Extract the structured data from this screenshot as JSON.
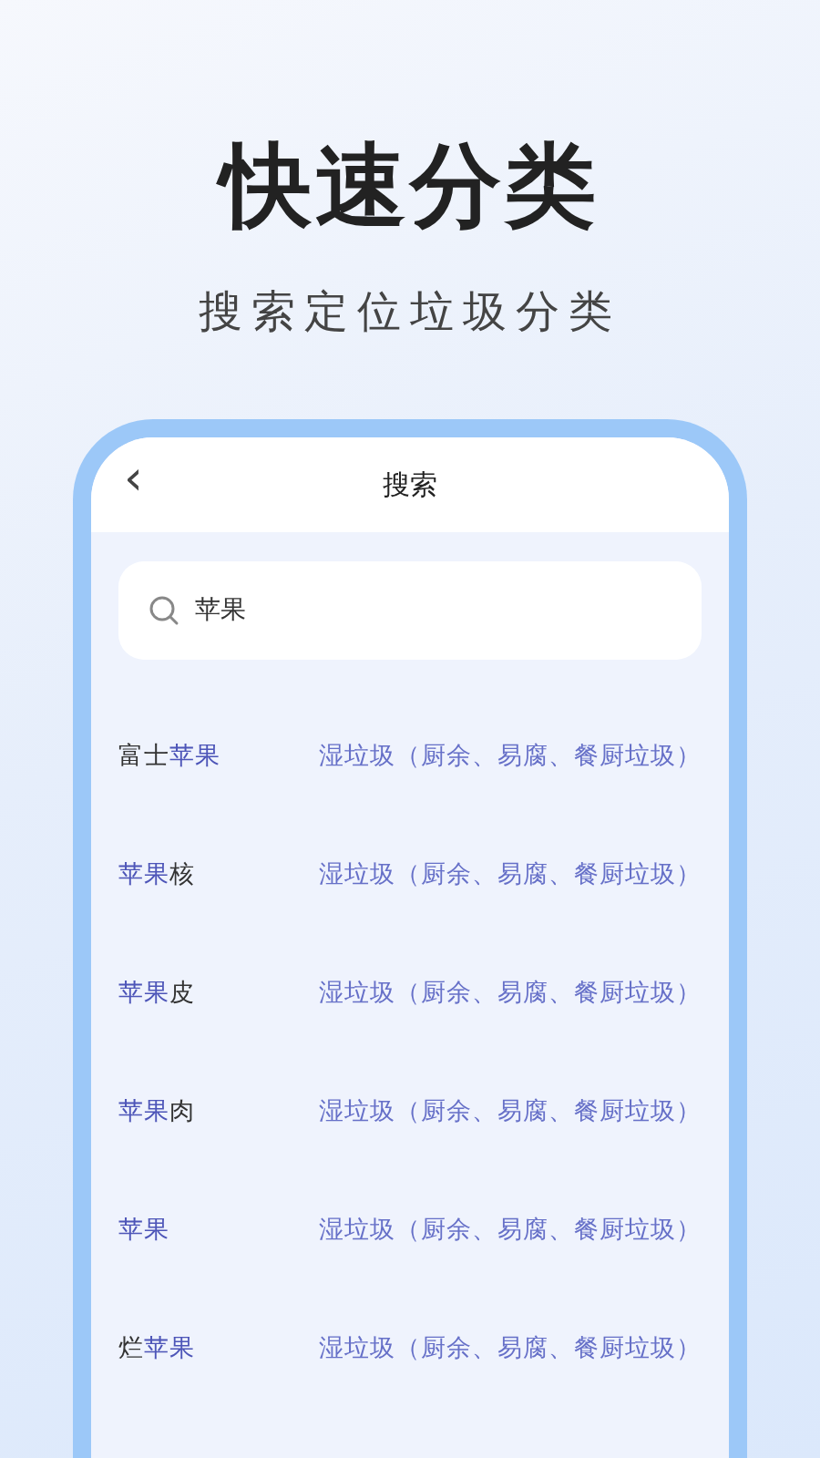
{
  "headline": "快速分类",
  "subtitle": "搜索定位垃圾分类",
  "screen": {
    "title": "搜索",
    "back_icon": "‹",
    "search": {
      "value": "苹果"
    },
    "results": [
      {
        "name": [
          {
            "text": "富士",
            "highlight": false
          },
          {
            "text": "苹果",
            "highlight": true
          }
        ],
        "category": "湿垃圾（厨余、易腐、餐厨垃圾）"
      },
      {
        "name": [
          {
            "text": "苹果",
            "highlight": true
          },
          {
            "text": "核",
            "highlight": false
          }
        ],
        "category": "湿垃圾（厨余、易腐、餐厨垃圾）"
      },
      {
        "name": [
          {
            "text": "苹果",
            "highlight": true
          },
          {
            "text": "皮",
            "highlight": false
          }
        ],
        "category": "湿垃圾（厨余、易腐、餐厨垃圾）"
      },
      {
        "name": [
          {
            "text": "苹果",
            "highlight": true
          },
          {
            "text": "肉",
            "highlight": false
          }
        ],
        "category": "湿垃圾（厨余、易腐、餐厨垃圾）"
      },
      {
        "name": [
          {
            "text": "苹果",
            "highlight": true
          }
        ],
        "category": "湿垃圾（厨余、易腐、餐厨垃圾）"
      },
      {
        "name": [
          {
            "text": "烂",
            "highlight": false
          },
          {
            "text": "苹果",
            "highlight": true
          }
        ],
        "category": "湿垃圾（厨余、易腐、餐厨垃圾）"
      }
    ]
  }
}
